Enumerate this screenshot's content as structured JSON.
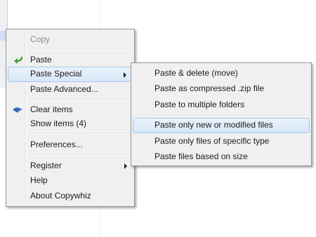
{
  "context_menu": {
    "copy": "Copy",
    "paste": "Paste",
    "paste_special": "Paste Special",
    "paste_advanced": "Paste Advanced...",
    "clear_items": "Clear items",
    "show_items": "Show items (4)",
    "preferences": "Preferences...",
    "register": "Register",
    "help": "Help",
    "about": "About Copywhiz"
  },
  "submenu": {
    "paste_delete": "Paste & delete (move)",
    "paste_zip": "Paste as compressed .zip file",
    "paste_multiple": "Paste to multiple folders",
    "paste_new_modified": "Paste only new or modified files",
    "paste_specific_type": "Paste only files of specific type",
    "paste_by_size": "Paste files based on size"
  },
  "colors": {
    "menu_background": "#f0f0f0",
    "highlight": "#d7e7f8",
    "highlight_border": "#a8c8ec",
    "paste_icon": "#3a9a3a",
    "clear_icon": "#2f6fc0"
  },
  "icons": {
    "paste": "paste-arrow-icon",
    "clear_items": "clear-items-icon",
    "submenu": "chevron-right-icon"
  }
}
